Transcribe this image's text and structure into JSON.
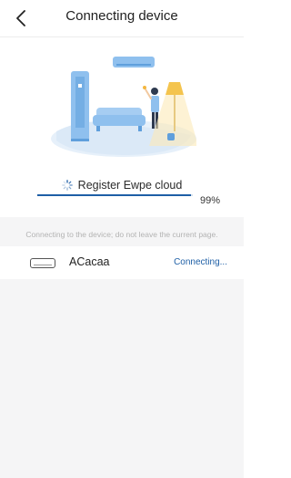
{
  "header": {
    "title": "Connecting device",
    "back_icon": "chevron-left-icon"
  },
  "illustration": {
    "icon": "air-conditioner-living-room-illustration"
  },
  "progress": {
    "spinner_icon": "loading-spinner-icon",
    "status_text": "Register Ewpe cloud",
    "percent_text": "99%",
    "value": 0.99
  },
  "notice": "Connecting to the device; do not leave the current page.",
  "device": {
    "name": "ACacaa",
    "status": "Connecting...",
    "icon": "air-conditioner-unit-icon"
  },
  "colors": {
    "accent": "#1e5fa6",
    "muted": "#b3b3b3",
    "panel": "#f5f5f6"
  }
}
